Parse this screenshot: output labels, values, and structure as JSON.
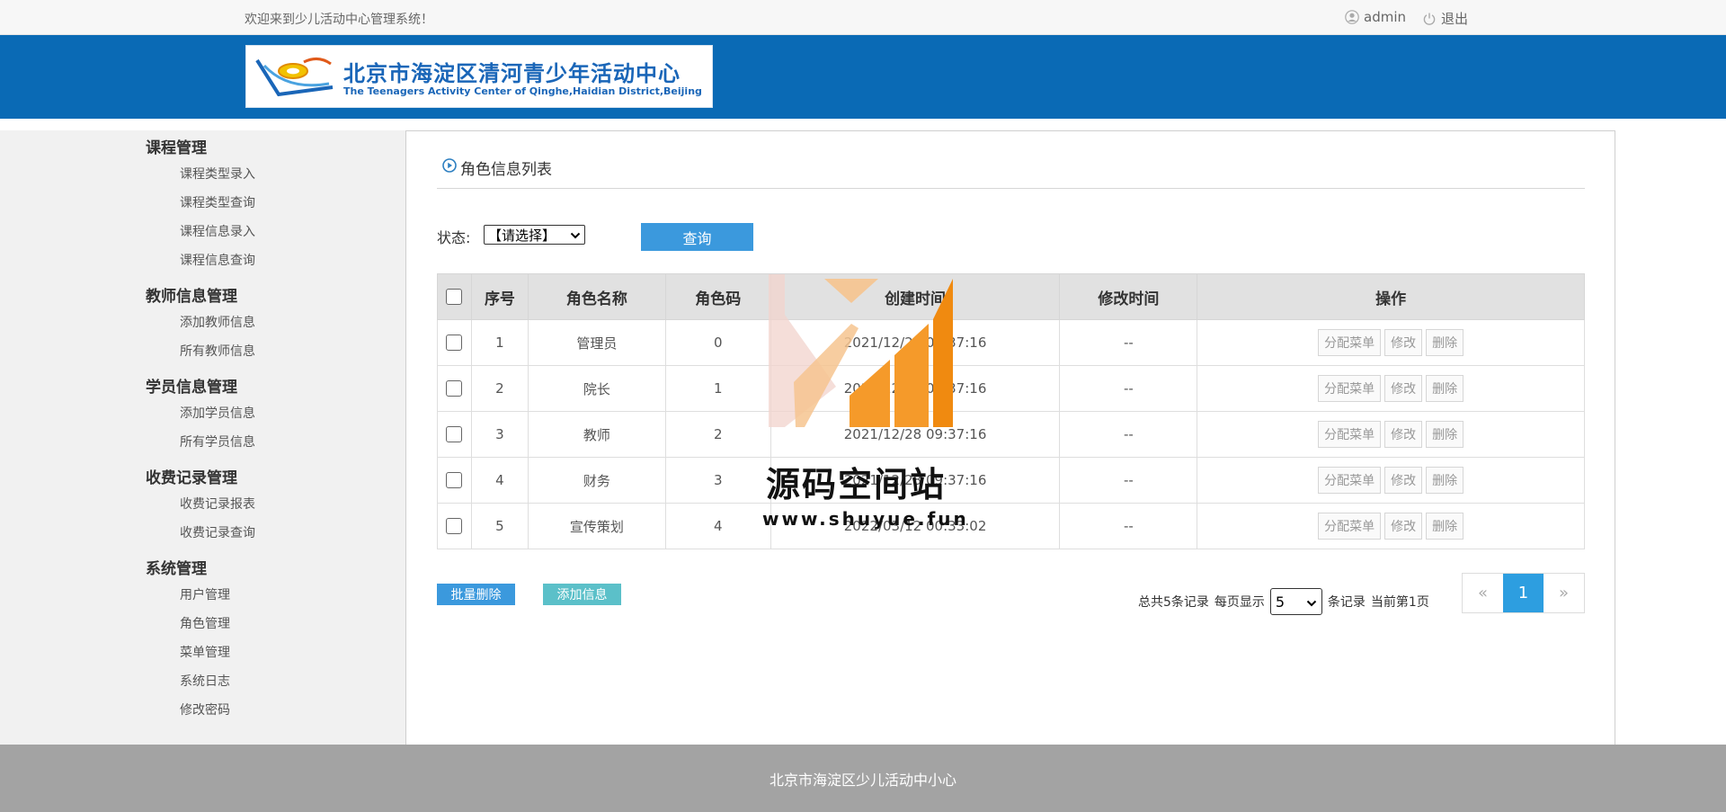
{
  "topbar": {
    "welcome": "欢迎来到少儿活动中心管理系统！",
    "user": "admin",
    "logout": "退出"
  },
  "logo": {
    "cn": "北京市海淀区清河青少年活动中心",
    "en": "The Teenagers Activity Center of Qinghe,Haidian District,Beijing"
  },
  "sidebar": {
    "groups": [
      {
        "label": "课程管理",
        "items": [
          "课程类型录入",
          "课程类型查询",
          "课程信息录入",
          "课程信息查询"
        ]
      },
      {
        "label": "教师信息管理",
        "items": [
          "添加教师信息",
          "所有教师信息"
        ]
      },
      {
        "label": "学员信息管理",
        "items": [
          "添加学员信息",
          "所有学员信息"
        ]
      },
      {
        "label": "收费记录管理",
        "items": [
          "收费记录报表",
          "收费记录查询"
        ]
      },
      {
        "label": "系统管理",
        "items": [
          "用户管理",
          "角色管理",
          "菜单管理",
          "系统日志",
          "修改密码"
        ]
      }
    ]
  },
  "main": {
    "title": "角色信息列表",
    "filter": {
      "label": "状态:",
      "selected": "【请选择】"
    },
    "query_label": "查询",
    "table": {
      "headers": [
        "序号",
        "角色名称",
        "角色码",
        "创建时间",
        "修改时间",
        "操作"
      ],
      "rows": [
        {
          "no": "1",
          "name": "管理员",
          "code": "0",
          "created": "2021/12/28 09:37:16",
          "modified": "--"
        },
        {
          "no": "2",
          "name": "院长",
          "code": "1",
          "created": "2021/12/28 09:37:16",
          "modified": "--"
        },
        {
          "no": "3",
          "name": "教师",
          "code": "2",
          "created": "2021/12/28 09:37:16",
          "modified": "--"
        },
        {
          "no": "4",
          "name": "财务",
          "code": "3",
          "created": "2021/12/28 09:37:16",
          "modified": "--"
        },
        {
          "no": "5",
          "name": "宣传策划",
          "code": "4",
          "created": "2022/03/12 00:33:02",
          "modified": "--"
        }
      ],
      "actions": [
        "分配菜单",
        "修改",
        "删除"
      ]
    },
    "batch_delete": "批量删除",
    "add_info": "添加信息",
    "pager": {
      "total": "总共5条记录",
      "per_page_label": "每页显示",
      "per_page": "5",
      "unit": "条记录",
      "current": "当前第1页",
      "prev": "«",
      "page": "1",
      "next": "»"
    }
  },
  "watermark": {
    "text": "源码空间站",
    "url": "www.shuyue.fun"
  },
  "footer": {
    "text": "北京市海淀区少儿活动中小心"
  },
  "colors": {
    "banner": "#0a6ab5",
    "primary_button": "#3b99dd",
    "add_button": "#5bc0c9",
    "footer": "#a3a3a3",
    "page_active": "#2d9ee0"
  }
}
